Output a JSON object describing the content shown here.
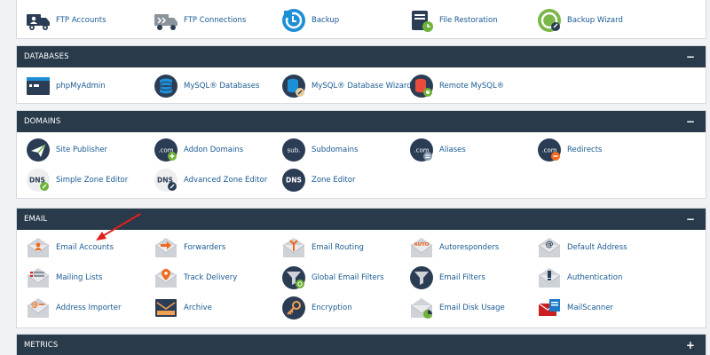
{
  "files": {
    "items": [
      {
        "label": "FTP Accounts",
        "icon": "ftp-accounts-icon"
      },
      {
        "label": "FTP Connections",
        "icon": "ftp-connections-icon"
      },
      {
        "label": "Backup",
        "icon": "backup-icon"
      },
      {
        "label": "File Restoration",
        "icon": "file-restoration-icon"
      },
      {
        "label": "Backup Wizard",
        "icon": "backup-wizard-icon"
      }
    ]
  },
  "databases": {
    "title": "DATABASES",
    "toggle": "−",
    "items": [
      {
        "label": "phpMyAdmin",
        "icon": "phpmyadmin-icon"
      },
      {
        "label": "MySQL® Databases",
        "icon": "mysql-databases-icon"
      },
      {
        "label": "MySQL® Database Wizard",
        "icon": "mysql-wizard-icon"
      },
      {
        "label": "Remote MySQL®",
        "icon": "remote-mysql-icon"
      }
    ]
  },
  "domains": {
    "title": "DOMAINS",
    "toggle": "−",
    "items": [
      {
        "label": "Site Publisher",
        "icon": "site-publisher-icon"
      },
      {
        "label": "Addon Domains",
        "icon": "addon-domains-icon",
        "glyph": ".com"
      },
      {
        "label": "Subdomains",
        "icon": "subdomains-icon",
        "glyph": "sub."
      },
      {
        "label": "Aliases",
        "icon": "aliases-icon",
        "glyph": ".com"
      },
      {
        "label": "Redirects",
        "icon": "redirects-icon",
        "glyph": ".com"
      },
      {
        "label": "Simple Zone Editor",
        "icon": "simple-zone-editor-icon",
        "glyph": "DNS"
      },
      {
        "label": "Advanced Zone Editor",
        "icon": "advanced-zone-editor-icon",
        "glyph": "DNS"
      },
      {
        "label": "Zone Editor",
        "icon": "zone-editor-icon",
        "glyph": "DNS"
      }
    ]
  },
  "email": {
    "title": "EMAIL",
    "toggle": "−",
    "items": [
      {
        "label": "Email Accounts",
        "icon": "email-accounts-icon"
      },
      {
        "label": "Forwarders",
        "icon": "forwarders-icon"
      },
      {
        "label": "Email Routing",
        "icon": "email-routing-icon"
      },
      {
        "label": "Autoresponders",
        "icon": "autoresponders-icon",
        "glyph": "AUTO"
      },
      {
        "label": "Default Address",
        "icon": "default-address-icon",
        "glyph": "@"
      },
      {
        "label": "Mailing Lists",
        "icon": "mailing-lists-icon"
      },
      {
        "label": "Track Delivery",
        "icon": "track-delivery-icon"
      },
      {
        "label": "Global Email Filters",
        "icon": "global-email-filters-icon"
      },
      {
        "label": "Email Filters",
        "icon": "email-filters-icon"
      },
      {
        "label": "Authentication",
        "icon": "authentication-icon"
      },
      {
        "label": "Address Importer",
        "icon": "address-importer-icon",
        "glyph": "@"
      },
      {
        "label": "Archive",
        "icon": "archive-icon"
      },
      {
        "label": "Encryption",
        "icon": "encryption-icon"
      },
      {
        "label": "Email Disk Usage",
        "icon": "email-disk-usage-icon"
      },
      {
        "label": "MailScanner",
        "icon": "mailscanner-icon"
      }
    ]
  },
  "metrics": {
    "title": "METRICS",
    "toggle": "+"
  },
  "colors": {
    "header": "#293a4a",
    "link": "#1a5a92",
    "accent_orange": "#f06a1d",
    "accent_green": "#6fb23a",
    "icon_dark": "#2b3d55",
    "annotation_arrow": "#e02020"
  }
}
